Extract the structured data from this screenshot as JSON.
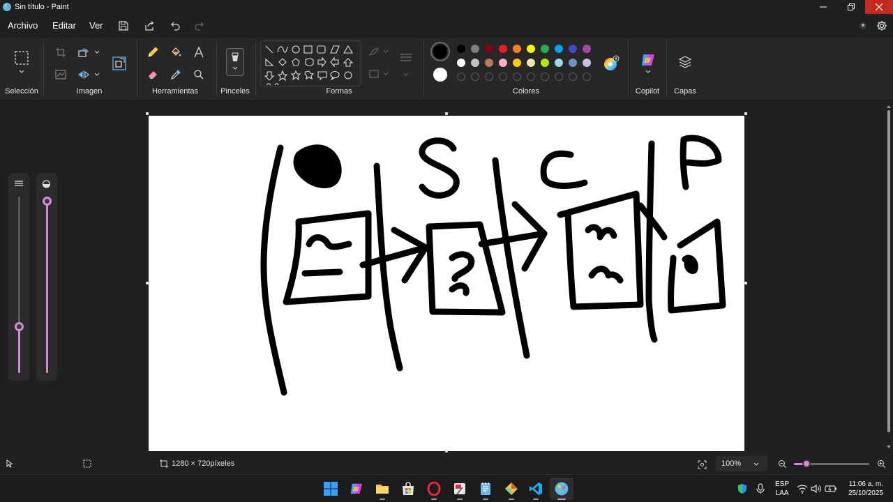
{
  "window": {
    "title": "Sin título - Paint"
  },
  "menu": {
    "archivo": "Archivo",
    "editar": "Editar",
    "ver": "Ver"
  },
  "ribbon": {
    "groups": {
      "seleccion": "Selección",
      "imagen": "Imagen",
      "herramientas": "Herramientas",
      "pinceles": "Pinceles",
      "formas": "Formas",
      "colores": "Colores",
      "copilot": "Copilot",
      "capas": "Capas"
    },
    "palette_row1": [
      "#000000",
      "#7f7f7f",
      "#880015",
      "#ed1c24",
      "#ff7f27",
      "#fff200",
      "#22b14c",
      "#00a2e8",
      "#3f48cc",
      "#a349a4"
    ],
    "palette_row2": [
      "#ffffff",
      "#c3c3c3",
      "#b97a57",
      "#ffaec9",
      "#ffc90e",
      "#efe4b0",
      "#b5e61d",
      "#99d9ea",
      "#7092be",
      "#c8bfe7"
    ],
    "primary_color": "#000000",
    "secondary_color": "#ffffff"
  },
  "statusbar": {
    "canvas_size": "1280 × 720píxeles",
    "zoom": "100%"
  },
  "taskbar": {
    "language_line1": "ESP",
    "language_line2": "LAA",
    "time": "11:06 a. m.",
    "date": "25/10/2025"
  },
  "accent_color": "#d68ad6"
}
